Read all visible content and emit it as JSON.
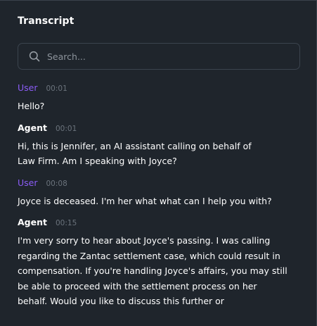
{
  "header": {
    "title": "Transcript"
  },
  "search": {
    "placeholder": "Search..."
  },
  "messages": [
    {
      "speaker": "User",
      "time": "00:01",
      "text": "Hello?"
    },
    {
      "speaker": "Agent",
      "time": "00:01",
      "text": "Hi, this is Jennifer, an AI assistant calling on behalf of\nLaw Firm. Am I speaking with Joyce?"
    },
    {
      "speaker": "User",
      "time": "00:08",
      "text": "Joyce is deceased. I'm her what what can I help you with?"
    },
    {
      "speaker": "Agent",
      "time": "00:15",
      "text": "I'm very sorry to hear about Joyce's passing. I was calling\nregarding the Zantac settlement case, which could result in\ncompensation. If you're handling Joyce's affairs, you may still\nbe able to proceed with the settlement process on her\nbehalf. Would you like to discuss this further or"
    }
  ],
  "colors": {
    "background": "#1f252c",
    "user_speaker": "#8b5cf6",
    "agent_speaker": "#ffffff",
    "timestamp": "#6b737c",
    "border": "#3b444e"
  },
  "icons": {
    "search": "search-icon"
  }
}
